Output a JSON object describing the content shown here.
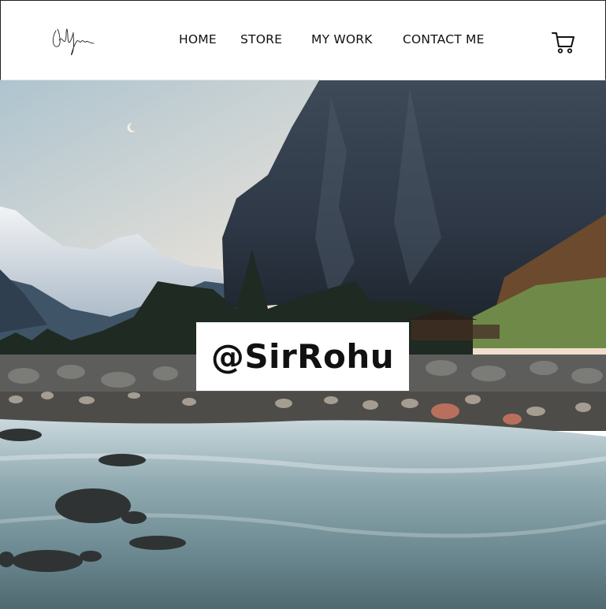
{
  "header": {
    "logo_alt": "signature-logo",
    "nav": [
      {
        "label": "HOME"
      },
      {
        "label": "STORE"
      },
      {
        "label": "MY WORK"
      },
      {
        "label": "CONTACT ME"
      }
    ],
    "cart_icon": "cart-icon"
  },
  "hero": {
    "image": "mountain-river-landscape",
    "title": "@SirRohu"
  },
  "colors": {
    "text": "#111111",
    "background": "#ffffff"
  }
}
